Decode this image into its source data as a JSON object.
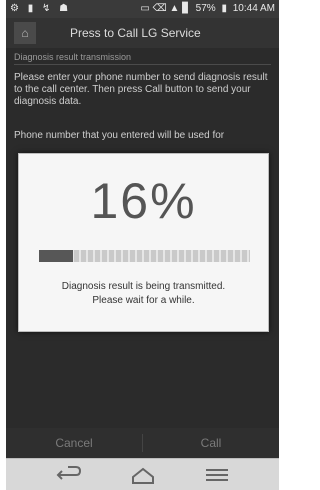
{
  "status_bar": {
    "battery": "57%",
    "time": "10:44 AM"
  },
  "header": {
    "title": "Press to Call LG Service"
  },
  "content": {
    "section_label": "Diagnosis result transmission",
    "description": "Please enter your phone number to send diagnosis result to the call center. Then press Call button to send your diagnosis data.",
    "phone_note": "Phone number that you entered will be used for"
  },
  "dialog": {
    "percent_text": "16%",
    "progress": 0.16,
    "message_line1": "Diagnosis result is being transmitted.",
    "message_line2": "Please wait for a while."
  },
  "actions": {
    "cancel_label": "Cancel",
    "call_label": "Call"
  },
  "navbar": {
    "back_icon": "back-icon",
    "home_icon": "home-icon",
    "menu_icon": "menu-icon"
  }
}
